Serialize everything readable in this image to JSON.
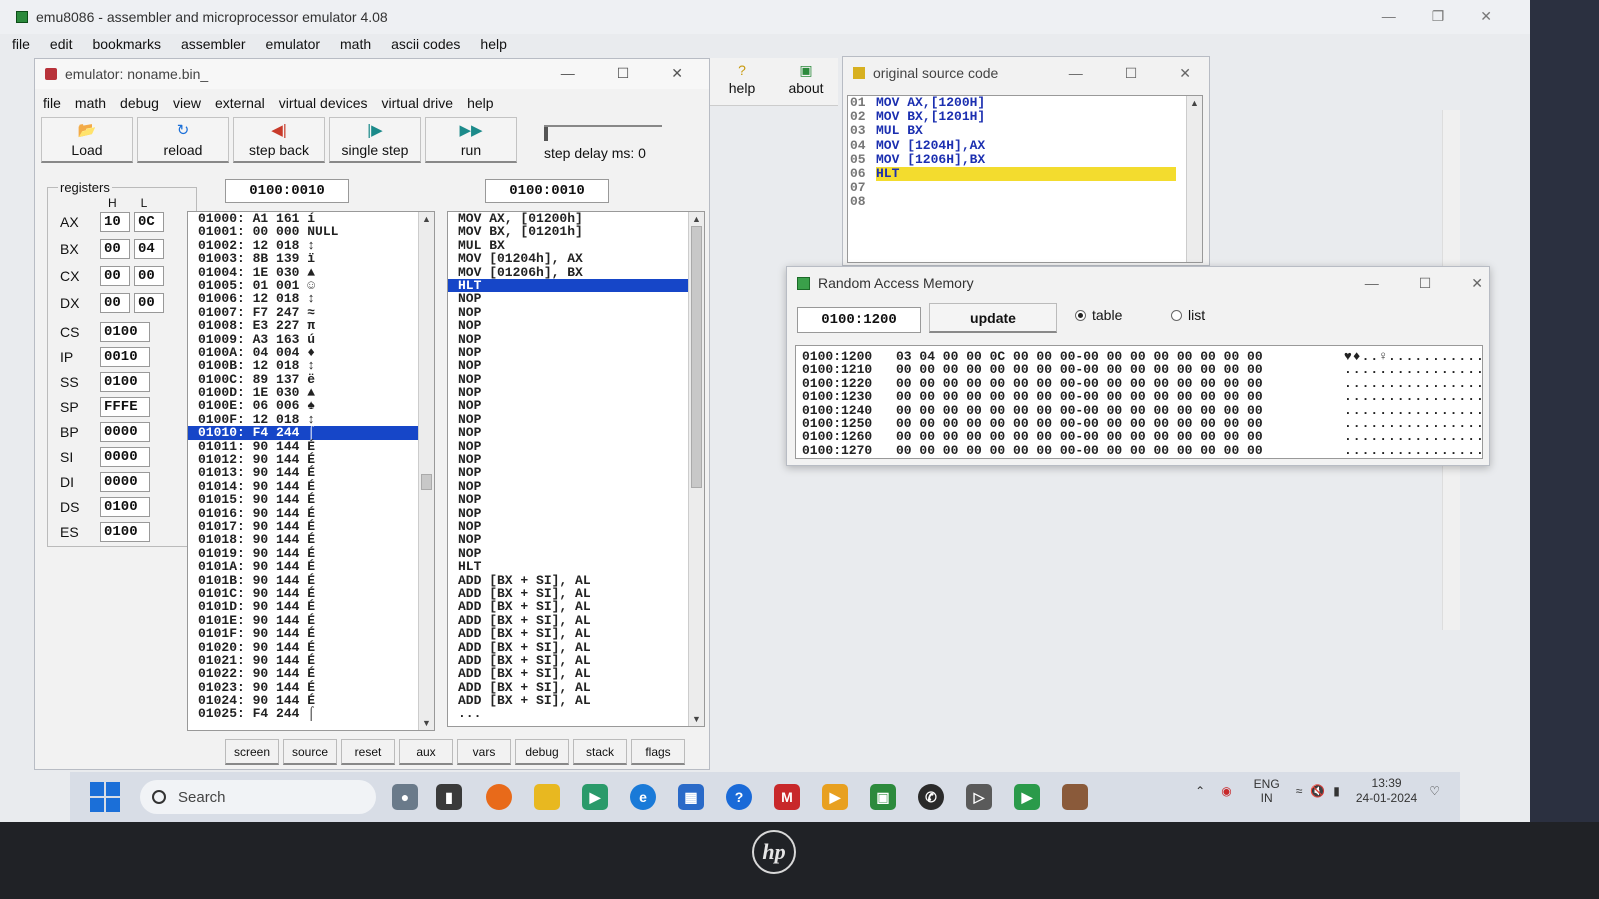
{
  "main_window": {
    "title": "emu8086 - assembler and microprocessor emulator 4.08",
    "menu": [
      "file",
      "edit",
      "bookmarks",
      "assembler",
      "emulator",
      "math",
      "ascii codes",
      "help"
    ]
  },
  "emulator": {
    "title": "emulator: noname.bin_",
    "menu": [
      "file",
      "math",
      "debug",
      "view",
      "external",
      "virtual devices",
      "virtual drive",
      "help"
    ],
    "toolbar": {
      "load": "Load",
      "reload": "reload",
      "step_back": "step back",
      "single_step": "single step",
      "run": "run",
      "step_delay": "step delay ms: 0"
    },
    "registers_label": "registers",
    "col_h": "H",
    "col_l": "L",
    "registers_split": [
      {
        "name": "AX",
        "h": "10",
        "l": "0C"
      },
      {
        "name": "BX",
        "h": "00",
        "l": "04"
      },
      {
        "name": "CX",
        "h": "00",
        "l": "00"
      },
      {
        "name": "DX",
        "h": "00",
        "l": "00"
      }
    ],
    "registers_full": [
      {
        "name": "CS",
        "value": "0100"
      },
      {
        "name": "IP",
        "value": "0010"
      },
      {
        "name": "SS",
        "value": "0100"
      },
      {
        "name": "SP",
        "value": "FFFE"
      },
      {
        "name": "BP",
        "value": "0000"
      },
      {
        "name": "SI",
        "value": "0000"
      },
      {
        "name": "DI",
        "value": "0000"
      },
      {
        "name": "DS",
        "value": "0100"
      },
      {
        "name": "ES",
        "value": "0100"
      }
    ],
    "mem_address": "0100:0010",
    "dis_address": "0100:0010",
    "memory_lines": [
      "01000: A1 161 í",
      "01001: 00 000 NULL",
      "01002: 12 018 ↕",
      "01003: 8B 139 ï",
      "01004: 1E 030 ▲",
      "01005: 01 001 ☺",
      "01006: 12 018 ↕",
      "01007: F7 247 ≈",
      "01008: E3 227 π",
      "01009: A3 163 ú",
      "0100A: 04 004 ♦",
      "0100B: 12 018 ↕",
      "0100C: 89 137 ë",
      "0100D: 1E 030 ▲",
      "0100E: 06 006 ♠",
      "0100F: 12 018 ↕",
      "01010: F4 244 ⌠",
      "01011: 90 144 É",
      "01012: 90 144 É",
      "01013: 90 144 É",
      "01014: 90 144 É",
      "01015: 90 144 É",
      "01016: 90 144 É",
      "01017: 90 144 É",
      "01018: 90 144 É",
      "01019: 90 144 É",
      "0101A: 90 144 É",
      "0101B: 90 144 É",
      "0101C: 90 144 É",
      "0101D: 90 144 É",
      "0101E: 90 144 É",
      "0101F: 90 144 É",
      "01020: 90 144 É",
      "01021: 90 144 É",
      "01022: 90 144 É",
      "01023: 90 144 É",
      "01024: 90 144 É",
      "01025: F4 244 ⌠"
    ],
    "memory_selected": 16,
    "disasm_lines": [
      "MOV AX, [01200h]",
      "MOV BX, [01201h]",
      "MUL BX",
      "MOV [01204h], AX",
      "MOV [01206h], BX",
      "HLT",
      "NOP",
      "NOP",
      "NOP",
      "NOP",
      "NOP",
      "NOP",
      "NOP",
      "NOP",
      "NOP",
      "NOP",
      "NOP",
      "NOP",
      "NOP",
      "NOP",
      "NOP",
      "NOP",
      "NOP",
      "NOP",
      "NOP",
      "NOP",
      "HLT",
      "ADD [BX + SI], AL",
      "ADD [BX + SI], AL",
      "ADD [BX + SI], AL",
      "ADD [BX + SI], AL",
      "ADD [BX + SI], AL",
      "ADD [BX + SI], AL",
      "ADD [BX + SI], AL",
      "ADD [BX + SI], AL",
      "ADD [BX + SI], AL",
      "ADD [BX + SI], AL",
      "..."
    ],
    "disasm_selected": 5,
    "bottom_tabs": [
      "screen",
      "source",
      "reset",
      "aux",
      "vars",
      "debug",
      "stack",
      "flags"
    ]
  },
  "help_about": {
    "help": "help",
    "about": "about"
  },
  "source_window": {
    "title": "original source code",
    "lines": [
      {
        "n": "01",
        "code": "MOV AX,[1200H]"
      },
      {
        "n": "02",
        "code": "MOV BX,[1201H]"
      },
      {
        "n": "03",
        "code": "MUL BX"
      },
      {
        "n": "04",
        "code": "MOV [1204H],AX"
      },
      {
        "n": "05",
        "code": "MOV [1206H],BX"
      },
      {
        "n": "06",
        "code": "HLT"
      },
      {
        "n": "07",
        "code": ""
      },
      {
        "n": "08",
        "code": ""
      }
    ],
    "highlighted": 5
  },
  "ram_window": {
    "title": "Random Access Memory",
    "address": "0100:1200",
    "update": "update",
    "table_option": "table",
    "list_option": "list",
    "selected_view": "table",
    "rows": [
      {
        "addr": "0100:1200",
        "bytes": "03 04 00 00 0C 00 00 00-00 00 00 00 00 00 00 00",
        "ascii": "♥♦..♀..........."
      },
      {
        "addr": "0100:1210",
        "bytes": "00 00 00 00 00 00 00 00-00 00 00 00 00 00 00 00",
        "ascii": "................"
      },
      {
        "addr": "0100:1220",
        "bytes": "00 00 00 00 00 00 00 00-00 00 00 00 00 00 00 00",
        "ascii": "................"
      },
      {
        "addr": "0100:1230",
        "bytes": "00 00 00 00 00 00 00 00-00 00 00 00 00 00 00 00",
        "ascii": "................"
      },
      {
        "addr": "0100:1240",
        "bytes": "00 00 00 00 00 00 00 00-00 00 00 00 00 00 00 00",
        "ascii": "................"
      },
      {
        "addr": "0100:1250",
        "bytes": "00 00 00 00 00 00 00 00-00 00 00 00 00 00 00 00",
        "ascii": "................"
      },
      {
        "addr": "0100:1260",
        "bytes": "00 00 00 00 00 00 00 00-00 00 00 00 00 00 00 00",
        "ascii": "................"
      },
      {
        "addr": "0100:1270",
        "bytes": "00 00 00 00 00 00 00 00-00 00 00 00 00 00 00 00",
        "ascii": "................"
      }
    ]
  },
  "taskbar": {
    "search_placeholder": "Search",
    "lang_top": "ENG",
    "lang_bottom": "IN",
    "time": "13:39",
    "date": "24-01-2024"
  }
}
